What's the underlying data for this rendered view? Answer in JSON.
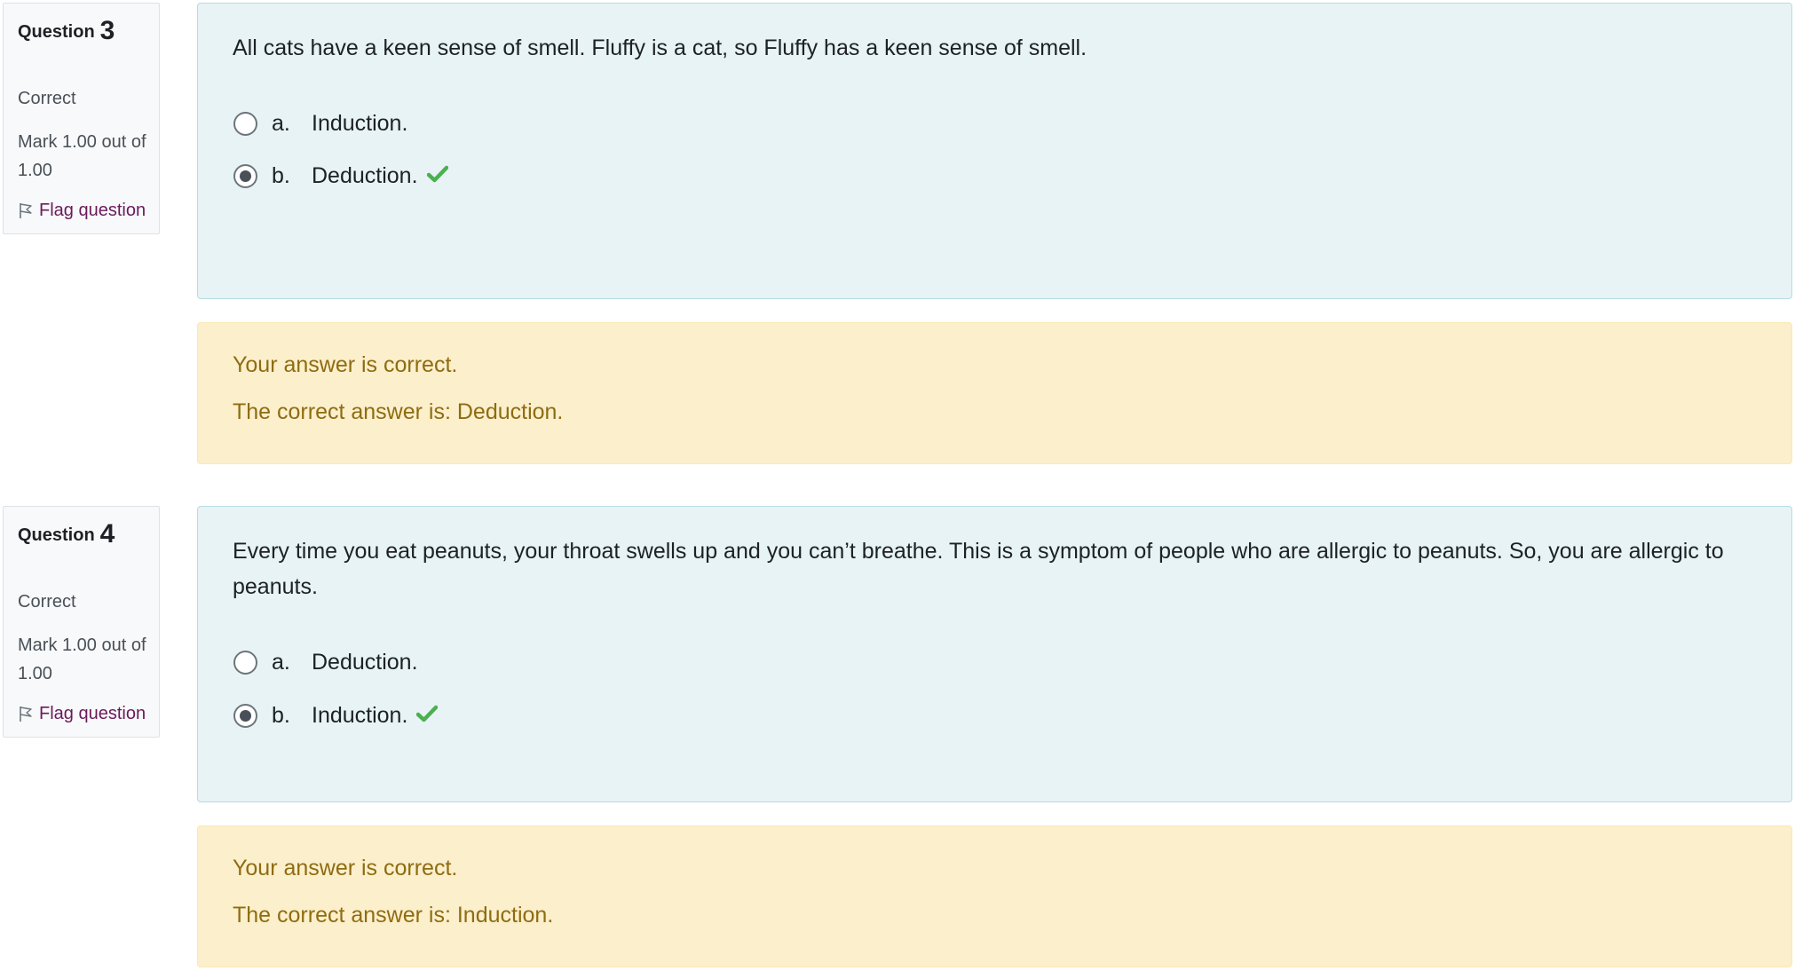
{
  "questions": [
    {
      "label": "Question",
      "number": "3",
      "state": "Correct",
      "grade": "Mark 1.00 out of 1.00",
      "flag_label": "Flag question",
      "text": "All cats have a keen sense of smell. Fluffy is a cat, so Fluffy has a keen sense of smell.",
      "answers": [
        {
          "letter": "a.",
          "label": "Induction.",
          "selected": false
        },
        {
          "letter": "b.",
          "label": "Deduction.",
          "selected": true,
          "correct_mark": true
        }
      ],
      "feedback": "Your answer is correct.",
      "right_answer": "The correct answer is: Deduction."
    },
    {
      "label": "Question",
      "number": "4",
      "state": "Correct",
      "grade": "Mark 1.00 out of 1.00",
      "flag_label": "Flag question",
      "text": "Every time you eat peanuts, your throat swells up and you can’t breathe. This is a symptom of people who are allergic to peanuts. So, you are allergic to peanuts.",
      "answers": [
        {
          "letter": "a.",
          "label": "Deduction.",
          "selected": false
        },
        {
          "letter": "b.",
          "label": "Induction.",
          "selected": true,
          "correct_mark": true
        }
      ],
      "feedback": "Your answer is correct.",
      "right_answer": "The correct answer is: Induction."
    }
  ],
  "colors": {
    "formulation_bg": "#e7f3f5",
    "feedback_bg": "#fcefcc",
    "feedback_text": "#8e6c11",
    "flag_link": "#6a1b5a",
    "check_mark": "#4caf50"
  },
  "icons": {
    "flag": "flag-icon",
    "correct": "check-icon"
  }
}
